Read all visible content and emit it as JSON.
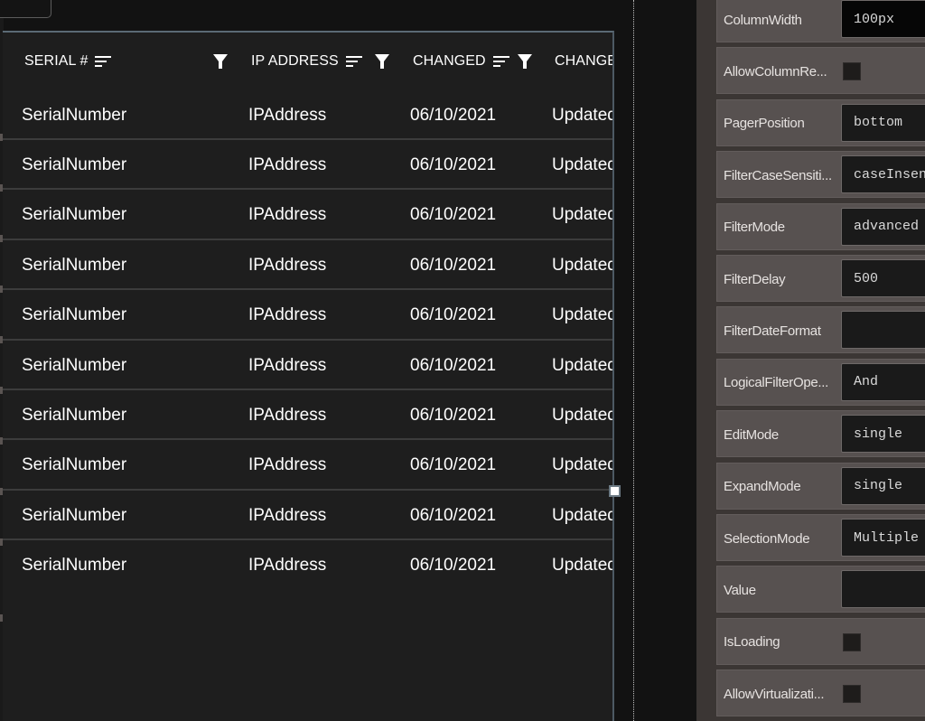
{
  "grid": {
    "columns": [
      {
        "label": "SERIAL #",
        "sortable": true,
        "filterable": true
      },
      {
        "label": "IP ADDRESS",
        "sortable": true,
        "filterable": true
      },
      {
        "label": "CHANGED",
        "sortable": true,
        "filterable": true
      },
      {
        "label": "CHANGE",
        "sortable": false,
        "filterable": false
      }
    ],
    "rows": [
      [
        "SerialNumber",
        "IPAddress",
        "06/10/2021",
        "Updated"
      ],
      [
        "SerialNumber",
        "IPAddress",
        "06/10/2021",
        "Updated"
      ],
      [
        "SerialNumber",
        "IPAddress",
        "06/10/2021",
        "Updated"
      ],
      [
        "SerialNumber",
        "IPAddress",
        "06/10/2021",
        "Updated"
      ],
      [
        "SerialNumber",
        "IPAddress",
        "06/10/2021",
        "Updated"
      ],
      [
        "SerialNumber",
        "IPAddress",
        "06/10/2021",
        "Updated"
      ],
      [
        "SerialNumber",
        "IPAddress",
        "06/10/2021",
        "Updated"
      ],
      [
        "SerialNumber",
        "IPAddress",
        "06/10/2021",
        "Updated"
      ],
      [
        "SerialNumber",
        "IPAddress",
        "06/10/2021",
        "Updated"
      ],
      [
        "SerialNumber",
        "IPAddress",
        "06/10/2021",
        "Updated"
      ]
    ]
  },
  "properties": [
    {
      "label": "ColumnWidth",
      "type": "text",
      "value": "100px"
    },
    {
      "label": "AllowColumnRe...",
      "type": "checkbox",
      "checked": false
    },
    {
      "label": "PagerPosition",
      "type": "text",
      "value": "bottom"
    },
    {
      "label": "FilterCaseSensiti...",
      "type": "text",
      "value": "caseInsensitive"
    },
    {
      "label": "FilterMode",
      "type": "text",
      "value": "advanced"
    },
    {
      "label": "FilterDelay",
      "type": "text",
      "value": "500"
    },
    {
      "label": "FilterDateFormat",
      "type": "text",
      "value": ""
    },
    {
      "label": "LogicalFilterOpe...",
      "type": "text",
      "value": "And"
    },
    {
      "label": "EditMode",
      "type": "text",
      "value": "single"
    },
    {
      "label": "ExpandMode",
      "type": "text",
      "value": "single"
    },
    {
      "label": "SelectionMode",
      "type": "text",
      "value": "Multiple"
    },
    {
      "label": "Value",
      "type": "text",
      "value": ""
    },
    {
      "label": "IsLoading",
      "type": "checkbox",
      "checked": false
    },
    {
      "label": "AllowVirtualizati...",
      "type": "checkbox",
      "checked": false
    }
  ],
  "icons": {
    "sort": "sort-lines-icon",
    "filter": "funnel-icon"
  }
}
